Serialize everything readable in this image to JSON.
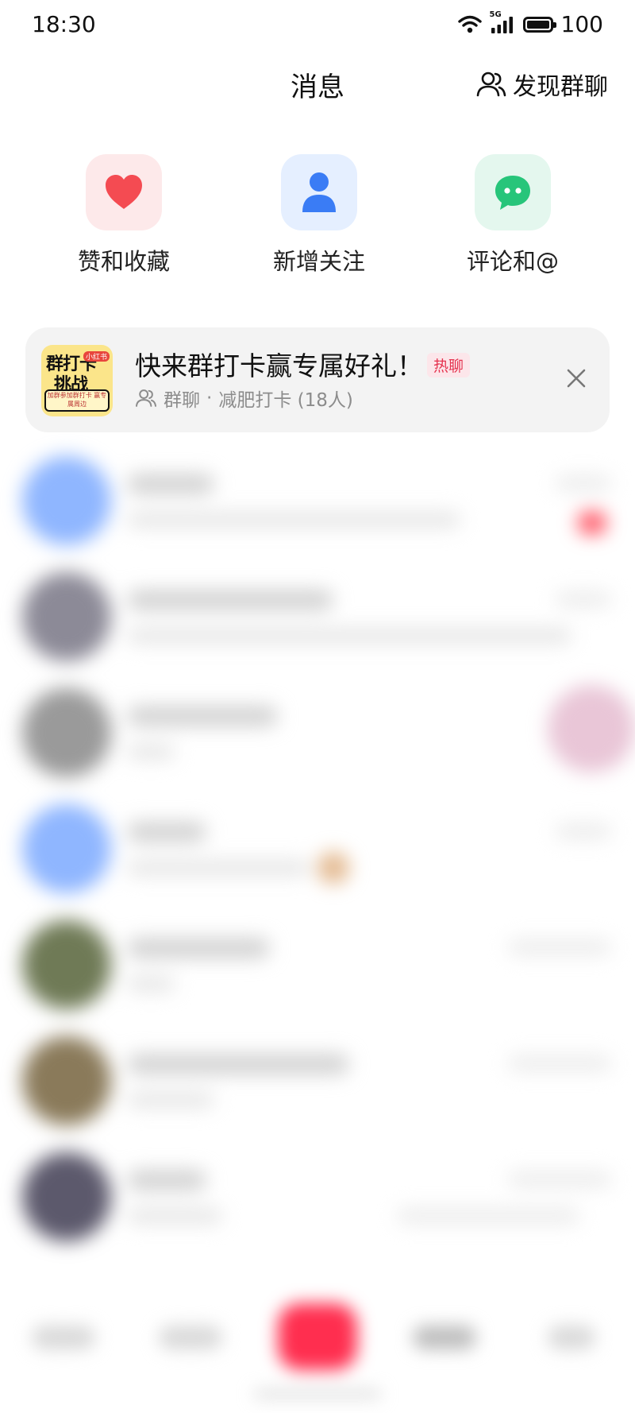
{
  "status_bar": {
    "time": "18:30",
    "network": "5G",
    "battery": "100",
    "battery_level": 1.0
  },
  "header": {
    "title": "消息",
    "discover_label": "发现群聊"
  },
  "shortcuts": [
    {
      "label": "赞和收藏",
      "icon": "heart-icon",
      "color": "#f44b52"
    },
    {
      "label": "新增关注",
      "icon": "person-icon",
      "color": "#3a7cf5"
    },
    {
      "label": "评论和@",
      "icon": "chat-bubble-icon",
      "color": "#27c57a"
    }
  ],
  "promo": {
    "title": "快来群打卡赢专属好礼！",
    "tag": "热聊",
    "type_label": "群聊",
    "separator": "·",
    "group_name": "减肥打卡 (18人)",
    "thumb_line1": "群打卡",
    "thumb_line2": "挑战",
    "thumb_badge": "小红书",
    "thumb_caption": "加群参加群打卡 赢专属周边"
  },
  "colors": {
    "accent": "#ff2e4f",
    "like": "#f44b52",
    "follow": "#3a7cf5",
    "comment": "#27c57a",
    "hot_tag": "#e5334f"
  }
}
